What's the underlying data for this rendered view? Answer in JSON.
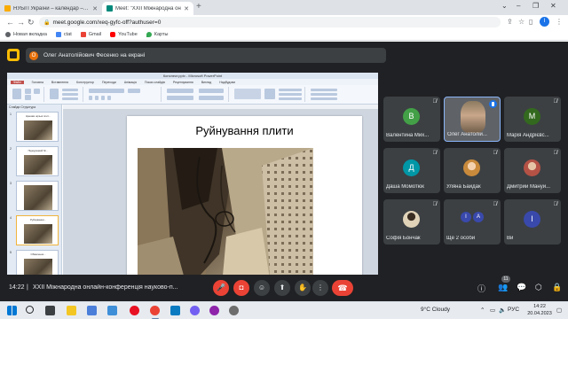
{
  "browser": {
    "tabs": [
      {
        "title": "НУБіП України – календар – нат",
        "active": false,
        "favicon_color": "#f9ab00"
      },
      {
        "title": "Meet: \"XXII Міжнародна он",
        "active": true,
        "favicon_color": "#00897b"
      }
    ],
    "new_tab_icon": "plus-icon",
    "url": "meet.google.com/xeq-gyfc-off?authuser=0",
    "bookmarks": [
      {
        "label": "Новая вкладка",
        "color": "#5f6368"
      },
      {
        "label": "ctat",
        "color": "#4285f4"
      },
      {
        "label": "Gmail",
        "color": "#ea4335"
      },
      {
        "label": "YouTube",
        "color": "#ff0000"
      },
      {
        "label": "Карты",
        "color": "#34a853"
      }
    ],
    "profile_initial": "I"
  },
  "meet": {
    "presenter_banner": "Олег Анатолійович Фесенко на екрані",
    "presenter_initial": "O",
    "time": "14:22",
    "separator": "|",
    "meeting_name": "XXII Міжнародна онлайн-конференція науково-п...",
    "participant_count": "11",
    "participants": [
      {
        "name": "Валентина Мих...",
        "initial": "В",
        "color": "#43a047"
      },
      {
        "name": "Олег Анатолій...",
        "initial": "",
        "color": "#5f6368",
        "speaking": true
      },
      {
        "name": "Марія Андрієвс...",
        "initial": "М",
        "color": "#33691e"
      },
      {
        "name": "Даша Момотюк",
        "initial": "Д",
        "color": "#0097a7"
      },
      {
        "name": "Уляна Байдак",
        "initial": "",
        "color": "#c98a3c"
      },
      {
        "name": "Дмитрий Мануй...",
        "initial": "",
        "color": "#b55246"
      },
      {
        "name": "Софія Бончак",
        "initial": "",
        "color": "#e0d3b8"
      },
      {
        "name": "Ще 2 особи",
        "initial": "",
        "color": "#3949ab",
        "stack": [
          "I",
          "A"
        ]
      },
      {
        "name": "Ви",
        "initial": "I",
        "color": "#3949ab"
      }
    ]
  },
  "slide": {
    "window_title": "Конспект.pptx - Microsoft PowerPoint",
    "ribbon_tabs": [
      "Файл",
      "Головна",
      "Вставлення",
      "Конструктор",
      "Переходи",
      "Анімація",
      "Показ слайдів",
      "Рецензування",
      "Вигляд",
      "Надбудови"
    ],
    "pane_tabs": "Слайди   Структура",
    "title": "Руйнування плити",
    "notes_placeholder": "Нотатки до слайда",
    "status": "Слайд 5 з 17     \"Тема Office\"     українська",
    "thumbnails": [
      {
        "num": "1",
        "text": "Цінники щільні плит..."
      },
      {
        "num": "2",
        "text": "Підмурковий бл..."
      },
      {
        "num": "3",
        "text": ""
      },
      {
        "num": "4",
        "text": "Руйнування..."
      },
      {
        "num": "5",
        "text": "Обвалення..."
      }
    ]
  },
  "taskbar": {
    "weather": "9°C  Cloudy",
    "language": "РУС",
    "time": "14:22",
    "date": "20.04.2023"
  }
}
